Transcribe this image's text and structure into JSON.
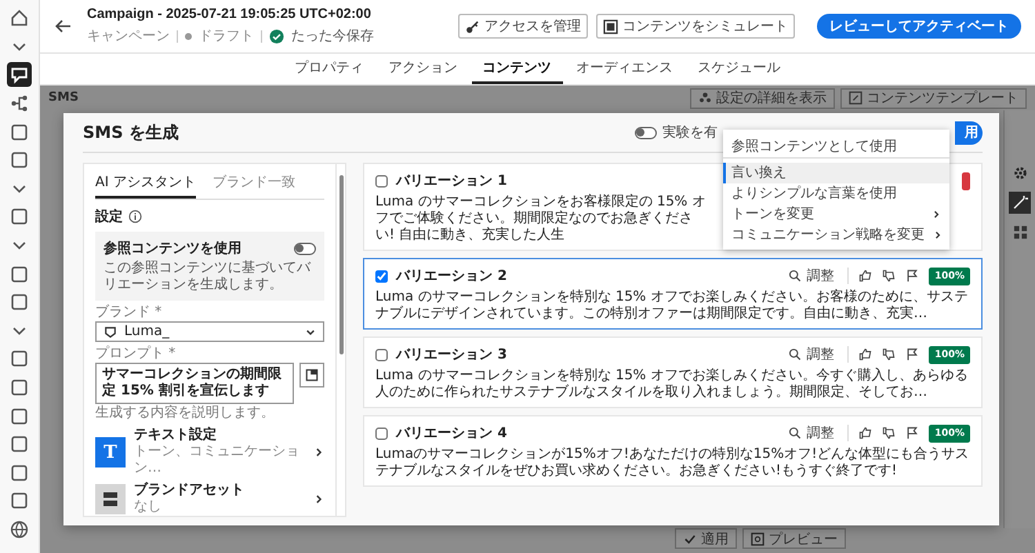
{
  "rail": [
    {
      "selected": false
    },
    {
      "selected": false
    },
    {
      "selected": true
    },
    {
      "selected": false
    },
    {
      "selected": false
    },
    {
      "selected": false
    },
    {
      "selected": false
    },
    {
      "selected": false
    },
    {
      "selected": false
    },
    {
      "selected": false
    },
    {
      "selected": false
    },
    {
      "selected": false
    },
    {
      "selected": false
    },
    {
      "selected": false
    },
    {
      "selected": false
    },
    {
      "selected": false
    },
    {
      "selected": false
    },
    {
      "selected": false
    },
    {
      "selected": false
    }
  ],
  "header": {
    "title": "Campaign - 2025-07-21 19:05:25 UTC+02:00",
    "breadcrumb": "キャンペーン",
    "status": "ドラフト",
    "saved": "たった今保存",
    "buttons": [
      {
        "label": "アクセスを管理",
        "kind": "key"
      },
      {
        "label": "コンテンツをシミュレート",
        "kind": "simulate"
      }
    ],
    "primary": "レビューしてアクティベート"
  },
  "tabs": [
    {
      "label": "プロパティ",
      "selected": false
    },
    {
      "label": "アクション",
      "selected": false
    },
    {
      "label": "コンテンツ",
      "selected": true
    },
    {
      "label": "オーディエンス",
      "selected": false
    },
    {
      "label": "スケジュール",
      "selected": false
    }
  ],
  "editor": {
    "channel": "SMS",
    "buttons": [
      {
        "label": "設定の詳細を表示",
        "kind": "people"
      },
      {
        "label": "コンテンツテンプレート",
        "kind": "template"
      }
    ],
    "footer_buttons": [
      {
        "label": "適用",
        "kind": "check"
      },
      {
        "label": "プレビュー",
        "kind": "preview"
      }
    ]
  },
  "modal": {
    "title": "SMS を生成",
    "experiment": {
      "label": "実験を有",
      "on": false
    },
    "primary_button": "用",
    "side_tabs": [
      {
        "label": "AI アシスタント",
        "selected": true
      },
      {
        "label": "ブランド一致",
        "selected": false
      }
    ],
    "settings_title": "設定",
    "reference": {
      "title": "参照コンテンツを使用",
      "on": false,
      "description": "この参照コンテンツに基づいてバリエーションを生成します。"
    },
    "brand": {
      "label": "ブランド *",
      "value": "Luma_"
    },
    "prompt": {
      "label": "プロンプト *",
      "value": "サマーコレクションの期間限定 15% 割引を宣伝します",
      "help": "生成する内容を説明します。"
    },
    "options": [
      {
        "title": "テキスト設定",
        "subtitle": "トーン、コミュニケーション…",
        "kind": "text",
        "letter": "T"
      },
      {
        "title": "ブランドアセット",
        "subtitle": "なし",
        "kind": "assets"
      }
    ],
    "variations": [
      {
        "title": "バリエーション 1",
        "checked": false,
        "selected": false,
        "text": "Luma のサマーコレクションをお客様限定の 15% オフでご体験ください。期間限定なのでお急ぎください! 自由に動き、充実した人生",
        "badge": {
          "color": "#d7373f"
        }
      },
      {
        "title": "バリエーション 2",
        "checked": true,
        "selected": true,
        "text": "Luma のサマーコレクションを特別な 15% オフでお楽しみください。お客様のために、サステナブルにデザインされています。この特別オファーは期間限定です。自由に動き、充実…",
        "adjust": "調整",
        "badge": {
          "text": "100%",
          "color": "#007a4d"
        }
      },
      {
        "title": "バリエーション 3",
        "checked": false,
        "selected": false,
        "text": "Luma のサマーコレクションを特別な 15% オフでお楽しみください。今すぐ購入し、あらゆる人のために作られたサステナブルなスタイルを取り入れましょう。期間限定、そしてお…",
        "adjust": "調整",
        "badge": {
          "text": "100%",
          "color": "#007a4d"
        }
      },
      {
        "title": "バリエーション 4",
        "checked": false,
        "selected": false,
        "text": "Lumaのサマーコレクションが15%オフ!あなただけの特別な15%オフ!どんな体型にも合うサステナブルなスタイルをぜひお買い求めください。お急ぎください!もうすぐ終了です!",
        "adjust": "調整",
        "badge": {
          "text": "100%",
          "color": "#007a4d"
        }
      }
    ],
    "menu": [
      {
        "label": "参照コンテンツとして使用",
        "highlighted": false,
        "submenu": false,
        "divider_after": true
      },
      {
        "label": "言い換え",
        "highlighted": true,
        "submenu": false,
        "divider_after": false
      },
      {
        "label": "よりシンプルな言葉を使用",
        "highlighted": false,
        "submenu": false,
        "divider_after": false
      },
      {
        "label": "トーンを変更",
        "highlighted": false,
        "submenu": true,
        "divider_after": false
      },
      {
        "label": "コミュニケーション戦略を変更",
        "highlighted": false,
        "submenu": true,
        "divider_after": false
      }
    ]
  }
}
